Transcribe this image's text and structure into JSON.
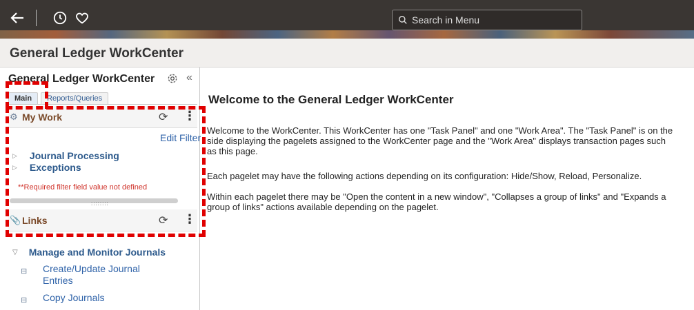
{
  "topbar": {
    "back_icon": "back-arrow-icon",
    "recent_icon": "history-clock-icon",
    "favorites_icon": "heart-icon",
    "search_placeholder": "Search in Menu"
  },
  "page": {
    "title": "General Ledger WorkCenter"
  },
  "panel": {
    "title": "General Ledger WorkCenter",
    "tabs": [
      {
        "label": "Main",
        "active": true
      },
      {
        "label": "Reports/Queries",
        "active": false
      }
    ],
    "my_work": {
      "title": "My Work",
      "edit_filters": "Edit Filter",
      "items": [
        {
          "label": "Journal Processing"
        },
        {
          "label": "Exceptions"
        }
      ],
      "required_msg": "**Required filter field value not defined",
      "grip": "::::::::"
    },
    "links": {
      "title": "Links",
      "group": "Manage and Monitor Journals",
      "items": [
        {
          "label_line1": "Create/Update Journal",
          "label_line2": "Entries"
        },
        {
          "label_line1": "Copy Journals",
          "label_line2": ""
        }
      ]
    }
  },
  "main": {
    "heading": "Welcome to the General Ledger WorkCenter",
    "paragraphs": [
      "Welcome to the WorkCenter. This WorkCenter has one \"Task Panel\" and one \"Work Area\". The \"Task Panel\" is on the side displaying the pagelets assigned to the WorkCenter page and the \"Work Area\" displays transaction pages such as this page.",
      "Each pagelet may have the following actions depending on its configuration: Hide/Show, Reload, Personalize.",
      "Within each pagelet there may be \"Open the content in a new window\", \"Collapses a group of links\" and \"Expands a group of links\" actions available depending on the pagelet."
    ]
  },
  "colors": {
    "highlight": "#e00000",
    "link": "#2e62a8",
    "header_bg": "#3a3633"
  }
}
